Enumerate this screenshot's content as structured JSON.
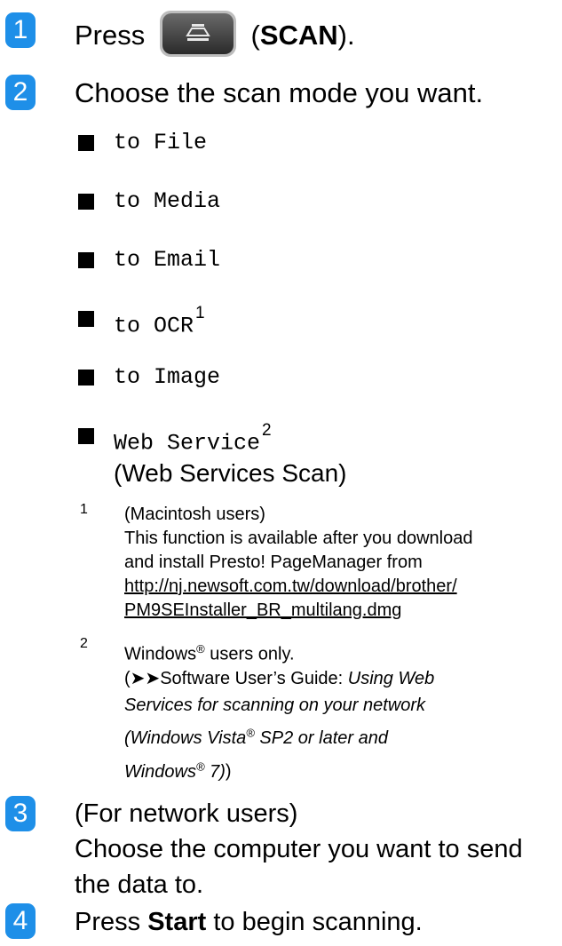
{
  "steps": [
    {
      "number": "1",
      "prefix": "Press",
      "button": "SCAN",
      "suffix_open": "(",
      "suffix_close": ")."
    },
    {
      "number": "2",
      "text": "Choose the scan mode you want."
    },
    {
      "number": "3",
      "line1": "(For network users)",
      "line2": "Choose the computer you want to send",
      "line3": "the data to."
    },
    {
      "number": "4",
      "prefix": "Press",
      "bold": "Start",
      "suffix": "to begin scanning."
    }
  ],
  "modes": [
    {
      "label": "to File"
    },
    {
      "label": "to Media"
    },
    {
      "label": "to Email"
    },
    {
      "label": "to OCR",
      "sup": "1"
    },
    {
      "label": "to Image"
    },
    {
      "label": "Web Service",
      "sup": "2",
      "sub": "(Web Services Scan)"
    }
  ],
  "footnotes": {
    "fn1": {
      "num": "1",
      "line1": "(Macintosh users)",
      "line2": "This function is available after you download",
      "line3": "and install Presto! PageManager from",
      "link1": "http://nj.newsoft.com.tw/download/brother/",
      "link2": "PM9SEInstaller_BR_multilang.dmg"
    },
    "fn2": {
      "num": "2",
      "l1_a": "Windows",
      "reg": "®",
      "l1_b": " users only.",
      "l2_a": "(",
      "arrows": "➤➤",
      "l2_b": "Software User’s Guide: ",
      "l2_i": "Using Web",
      "l3_i": "Services for scanning on your network",
      "l4_i_a": "(Windows Vista",
      "l4_i_b": " SP2 or later and",
      "l5_i_a": "Windows",
      "l5_i_b": " 7)",
      "l5_close": ")"
    }
  },
  "colors": {
    "badge": "#1e8fe8"
  }
}
